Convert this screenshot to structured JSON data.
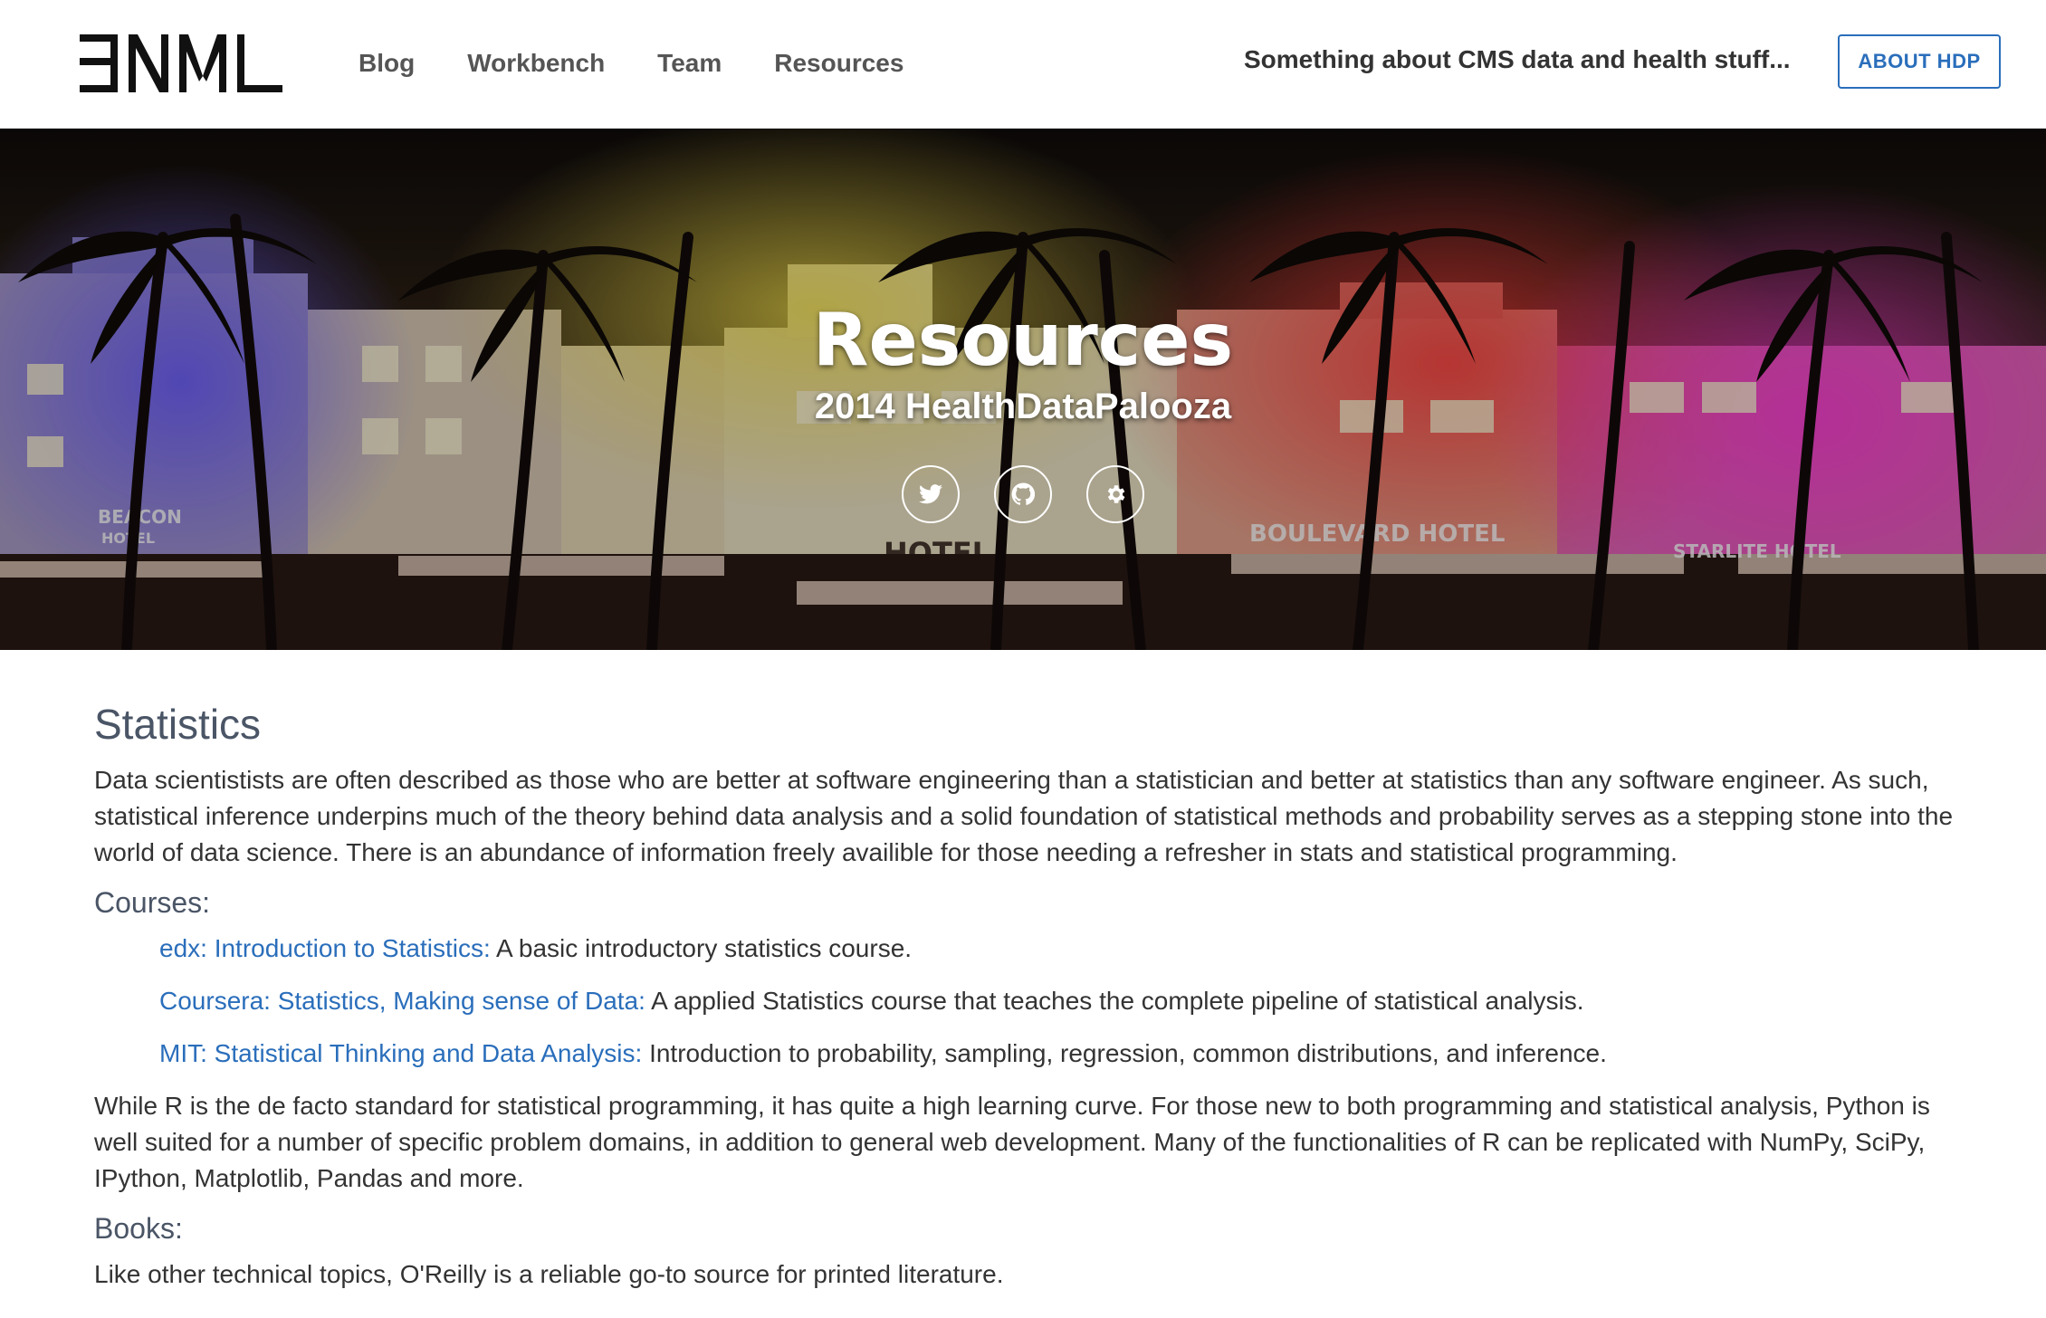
{
  "header": {
    "logo_text": "FNML",
    "nav": [
      {
        "label": "Blog"
      },
      {
        "label": "Workbench"
      },
      {
        "label": "Team"
      },
      {
        "label": "Resources"
      }
    ],
    "tagline": "Something about CMS data and health stuff...",
    "about_button": "ABOUT HDP",
    "accent_color": "#2a6ebb"
  },
  "hero": {
    "title": "Resources",
    "subtitle": "2014 HealthDataPalooza",
    "icons": [
      "twitter-icon",
      "github-icon",
      "gear-icon"
    ],
    "sign_texts": [
      "BEACON",
      "HOTEL",
      "HOTEL",
      "BOULEVARD HOTEL",
      "STARLITE HOTEL"
    ]
  },
  "content": {
    "section_title": "Statistics",
    "intro": "Data scientistists are often described as those who are better at software engineering than a statistician and better at statistics than any software engineer. As such, statistical inference underpins much of the theory behind data analysis and a solid foundation of statistical methods and probability serves as a stepping stone into the world of data science. There is an abundance of information freely availible for those needing a refresher in stats and statistical programming.",
    "courses_title": "Courses:",
    "courses": [
      {
        "link": "edx: Introduction to Statistics:",
        "desc": " A basic introductory statistics course."
      },
      {
        "link": "Coursera: Statistics, Making sense of Data:",
        "desc": " A applied Statistics course that teaches the complete pipeline of statistical analysis."
      },
      {
        "link": "MIT: Statistical Thinking and Data Analysis:",
        "desc": " Introduction to probability, sampling, regression, common distributions, and inference."
      }
    ],
    "python_para": "While R is the de facto standard for statistical programming, it has quite a high learning curve. For those new to both programming and statistical analysis, Python is well suited for a number of specific problem domains, in addition to general web development. Many of the functionalities of R can be replicated with NumPy, SciPy, IPython, Matplotlib, Pandas and more.",
    "books_title": "Books:",
    "books_para": "Like other technical topics, O'Reilly is a reliable go-to source for printed literature."
  }
}
